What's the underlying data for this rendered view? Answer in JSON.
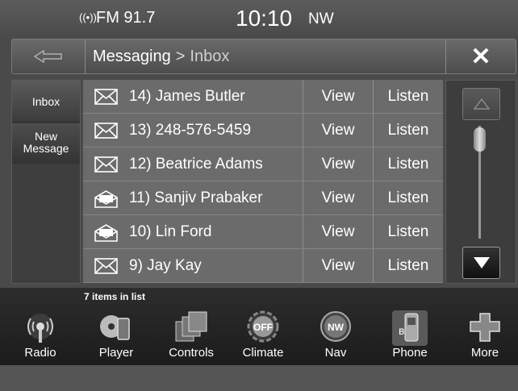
{
  "status": {
    "radio_icon": "radio-signal-icon",
    "radio": "FM 91.7",
    "clock": "10:10",
    "compass": "NW"
  },
  "header": {
    "back_icon": "back-arrow-icon",
    "breadcrumb": {
      "section": "Messaging",
      "separator": ">",
      "current": "Inbox"
    },
    "close_label": "✕"
  },
  "tabs": [
    {
      "label": "Inbox",
      "selected": true
    },
    {
      "label": "New Message",
      "line1": "New",
      "line2": "Message",
      "selected": false
    }
  ],
  "messages": [
    {
      "name": "14) James Butler",
      "icon": "envelope-closed-icon",
      "view": "View",
      "listen": "Listen"
    },
    {
      "name": "13) 248-576-5459",
      "icon": "envelope-closed-icon",
      "view": "View",
      "listen": "Listen"
    },
    {
      "name": "12) Beatrice Adams",
      "icon": "envelope-closed-icon",
      "view": "View",
      "listen": "Listen"
    },
    {
      "name": "11) Sanjiv Prabaker",
      "icon": "envelope-open-icon",
      "view": "View",
      "listen": "Listen"
    },
    {
      "name": "10) Lin Ford",
      "icon": "envelope-open-icon",
      "view": "View",
      "listen": "Listen"
    },
    {
      "name": "9) Jay Kay",
      "icon": "envelope-closed-icon",
      "view": "View",
      "listen": "Listen"
    }
  ],
  "list_count": "7 items in list",
  "nav": [
    {
      "label": "Radio",
      "icon": "radio-icon"
    },
    {
      "label": "Player",
      "icon": "player-icon"
    },
    {
      "label": "Controls",
      "icon": "controls-icon"
    },
    {
      "label": "Climate",
      "icon": "climate-icon",
      "icon_text": "OFF"
    },
    {
      "label": "Nav",
      "icon": "nav-compass-icon",
      "icon_text": "NW"
    },
    {
      "label": "Phone",
      "icon": "phone-icon"
    },
    {
      "label": "More",
      "icon": "more-icon"
    }
  ],
  "colors": {
    "panel": "#4a4a4a",
    "row": "#6b6b6b",
    "text": "#ffffff",
    "bottombar": "#1c1c1c"
  }
}
